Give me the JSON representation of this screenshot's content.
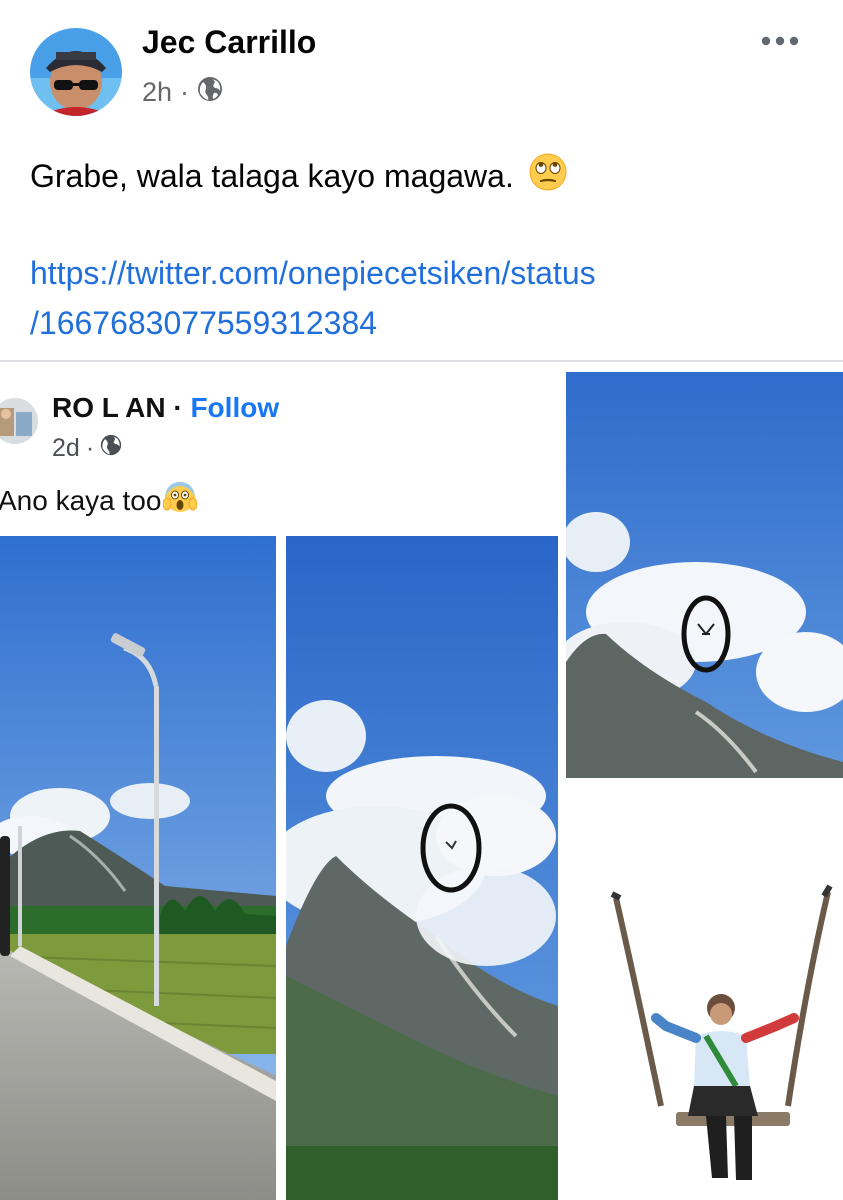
{
  "post": {
    "author": "Jec Carrillo",
    "time": "2h",
    "separator": "·",
    "privacy_icon": "globe-icon",
    "more_icon": "more-options-icon",
    "caption": "Grabe, wala talaga kayo magawa.",
    "caption_emoji": "face-with-rolling-eyes",
    "link_line1": "https://twitter.com/onepiecetsiken/status",
    "link_line2": "/1667683077559312384"
  },
  "shared": {
    "author": "RO L AN",
    "separator": "·",
    "follow_label": "Follow",
    "time": "2d",
    "privacy_icon": "globe-icon",
    "caption": "Ano kaya too",
    "caption_emoji": "face-screaming-in-fear"
  },
  "colors": {
    "link": "#216fdb",
    "follow": "#1877f2",
    "meta": "#65676b",
    "divider": "#dddfe2",
    "sky": "#3f80d4",
    "circle_marker": "#111111"
  }
}
